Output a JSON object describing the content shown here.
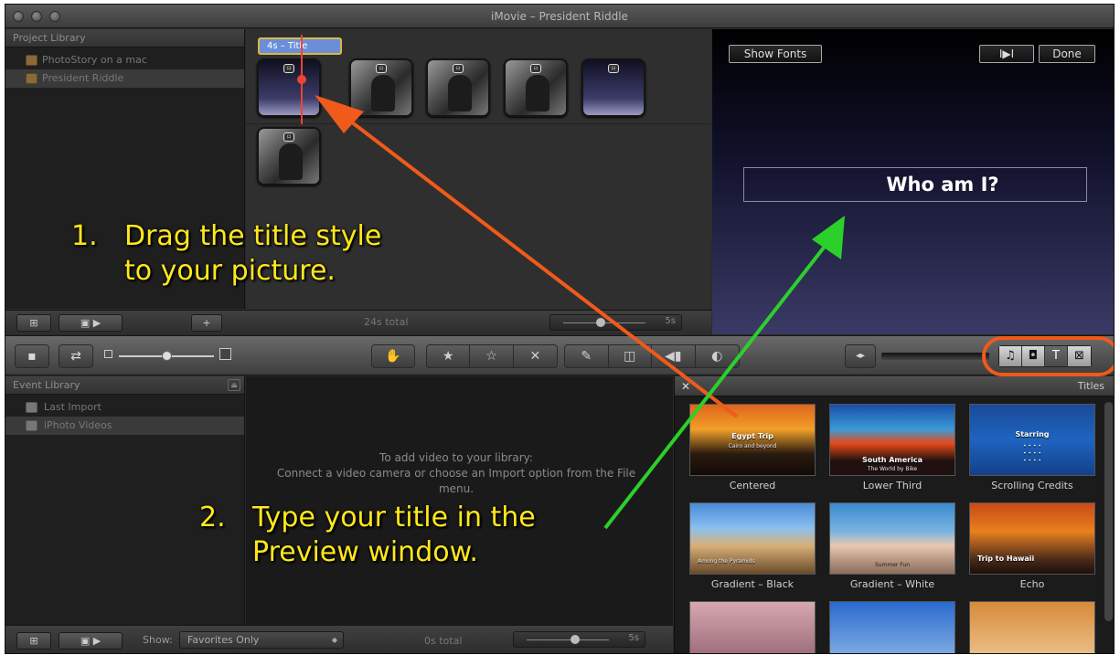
{
  "window": {
    "title": "iMovie – President Riddle"
  },
  "project_library": {
    "header": "Project Library",
    "items": [
      {
        "label": "PhotoStory on a mac",
        "icon": "project-icon"
      },
      {
        "label": "President Riddle",
        "icon": "project-icon",
        "selected": true
      }
    ]
  },
  "project": {
    "title_tag": "4s – Title",
    "clips": [
      {
        "kind": "title"
      },
      {
        "kind": "photo"
      },
      {
        "kind": "photo"
      },
      {
        "kind": "photo"
      },
      {
        "kind": "title"
      },
      {
        "kind": "photo"
      }
    ],
    "total": "24s total",
    "zoom_label": "5s"
  },
  "viewer": {
    "show_fonts": "Show Fonts",
    "play_label": "I▶I",
    "done": "Done",
    "title_text": "Who am I?"
  },
  "toolbar": {
    "icons": [
      "camera-icon",
      "swap-icon",
      "crop-icon",
      "favorite-icon",
      "unfavorite-icon",
      "reject-icon",
      "voiceover-icon",
      "crop-rotate-icon",
      "audio-icon",
      "color-icon"
    ],
    "browser_buttons": [
      {
        "name": "music-icon",
        "glyph": "♫"
      },
      {
        "name": "photo-icon",
        "glyph": "◘"
      },
      {
        "name": "titles-icon",
        "glyph": "T",
        "active": true
      },
      {
        "name": "transitions-icon",
        "glyph": "⊠"
      }
    ]
  },
  "event_library": {
    "header": "Event Library",
    "items": [
      {
        "label": "Last Import"
      },
      {
        "label": "iPhoto Videos",
        "selected": true
      }
    ]
  },
  "event_browser": {
    "message_line1": "To add video to your library:",
    "message_line2": "Connect a video camera or choose an Import option from the File",
    "message_line3": "menu."
  },
  "titles_browser": {
    "header": "Titles",
    "cards": [
      {
        "label": "Centered",
        "text": "Egypt Trip",
        "sub": "Cairo and beyond"
      },
      {
        "label": "Lower Third",
        "text": "South America",
        "sub": "The World by Bike"
      },
      {
        "label": "Scrolling Credits",
        "text": "Starring",
        "sub": ""
      },
      {
        "label": "Gradient – Black",
        "text": "Among the Pyramids",
        "sub": ""
      },
      {
        "label": "Gradient – White",
        "text": "Summer Fun",
        "sub": ""
      },
      {
        "label": "Echo",
        "text": "Trip to Hawaii",
        "sub": ""
      }
    ]
  },
  "status": {
    "show_label": "Show:",
    "show_value": "Favorites Only",
    "total": "0s total",
    "zoom_label": "5s"
  },
  "annotations": {
    "step1_num": "1.",
    "step1_line1": "Drag the title style",
    "step1_line2": "to your picture.",
    "step2_num": "2.",
    "step2_line1": "Type your title in the",
    "step2_line2": "Preview window."
  },
  "colors": {
    "annotation_text": "#ffe81a",
    "orange_arrow": "#f05a1a",
    "green_arrow": "#2bd02b",
    "title_tag": "#6a8fd8"
  }
}
